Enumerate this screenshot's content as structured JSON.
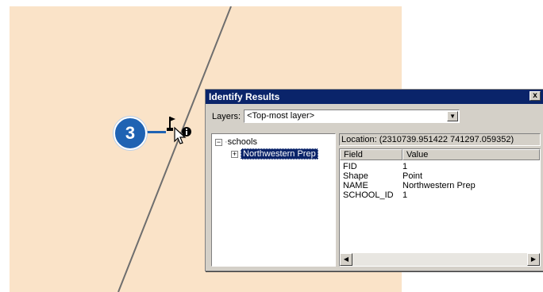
{
  "step_number": "3",
  "dialog": {
    "title": "Identify Results",
    "close_label": "x",
    "layers_label": "Layers:",
    "layers_value": "<Top-most layer>",
    "location": "Location: (2310739.951422 741297.059352)",
    "tree": {
      "root_label": "schools",
      "root_expander": "−",
      "child_label": "Northwestern Prep",
      "child_expander": "+"
    },
    "grid": {
      "columns": [
        "Field",
        "Value"
      ],
      "rows": [
        {
          "field": "FID",
          "value": "1"
        },
        {
          "field": "Shape",
          "value": "Point"
        },
        {
          "field": "NAME",
          "value": "Northwestern Prep"
        },
        {
          "field": "SCHOOL_ID",
          "value": "1"
        }
      ]
    }
  },
  "colors": {
    "map_background": "#fae3c8",
    "step_badge": "#1f63b3",
    "titlebar": "#0a246a"
  }
}
